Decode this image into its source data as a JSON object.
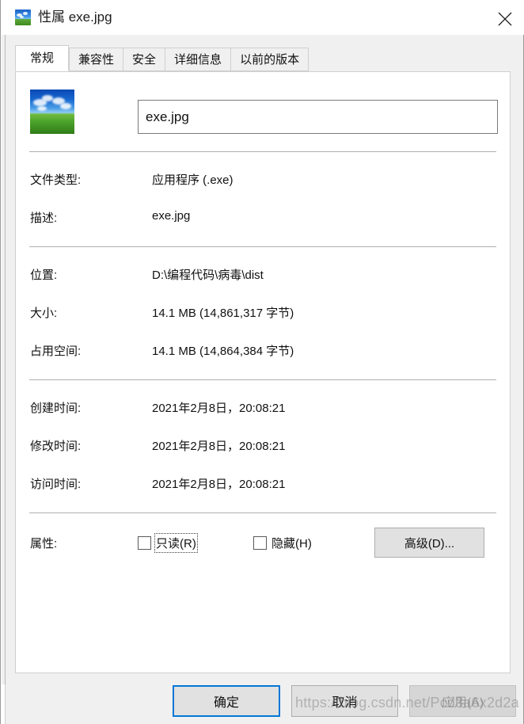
{
  "window": {
    "title": "性属 exe.jpg",
    "icon": "image-thumbnail-icon",
    "close_label": "×"
  },
  "tabs": [
    {
      "label": "常规",
      "active": true
    },
    {
      "label": "兼容性",
      "active": false
    },
    {
      "label": "安全",
      "active": false
    },
    {
      "label": "详细信息",
      "active": false
    },
    {
      "label": "以前的版本",
      "active": false
    }
  ],
  "general": {
    "filename_value": "exe.jpg",
    "filename_placeholder": "",
    "rows": [
      {
        "label": "文件类型:",
        "value": "应用程序 (.exe)"
      },
      {
        "label": "描述:",
        "value": "exe.jpg"
      },
      {
        "label": "位置:",
        "value": "D:\\编程代码\\病毒\\dist"
      },
      {
        "label": "大小:",
        "value": "14.1 MB (14,861,317 字节)"
      },
      {
        "label": "占用空间:",
        "value": "14.1 MB (14,864,384 字节)"
      },
      {
        "label": "创建时间:",
        "value": "2021年2月8日，20:08:21"
      },
      {
        "label": "修改时间:",
        "value": "2021年2月8日，20:08:21"
      },
      {
        "label": "访问时间:",
        "value": "2021年2月8日，20:08:21"
      }
    ],
    "attributes": {
      "label": "属性:",
      "readonly": {
        "text": "只读(R)",
        "checked": false,
        "focused": true
      },
      "hidden": {
        "text": "隐藏(H)",
        "checked": false,
        "focused": false
      },
      "advanced_button": "高级(D)..."
    }
  },
  "footer": {
    "ok": "确定",
    "cancel": "取消",
    "apply": "应用(A)"
  },
  "watermark": "https://blog.csdn.net/Pcd3a6x2d2a",
  "colors": {
    "accent": "#0078d7",
    "dialog_bg": "#f0f0f0",
    "panel_bg": "#ffffff",
    "button_bg": "#e1e1e1",
    "separator": "#b0b0b0",
    "text": "#111111",
    "disabled_text": "#a0a0a0"
  }
}
